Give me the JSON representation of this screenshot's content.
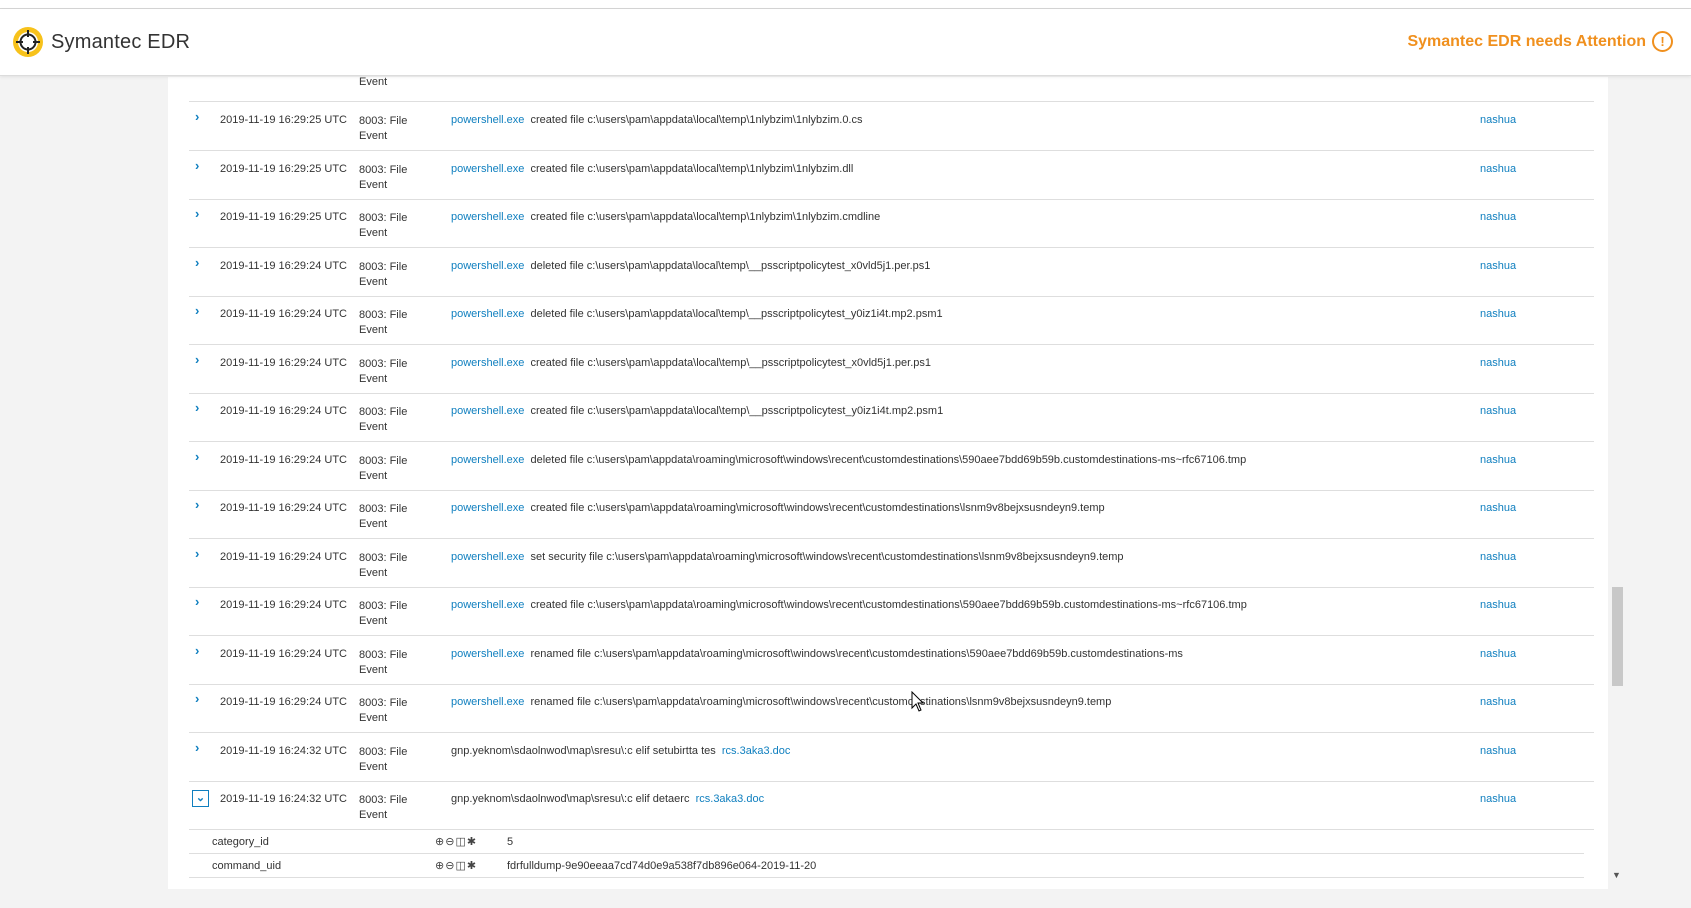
{
  "app": {
    "brand": "Symantec EDR",
    "attention": "Symantec EDR needs Attention",
    "attention_icon": "!"
  },
  "events": {
    "partial_top_type": "Event",
    "rows": [
      {
        "time": "2019-11-19 16:29:25 UTC",
        "type": "8003: File Event",
        "process": "powershell.exe",
        "action": "created file c:\\users\\pam\\appdata\\local\\temp\\1nlybzim\\1nlybzim.0.cs",
        "user": "nashua"
      },
      {
        "time": "2019-11-19 16:29:25 UTC",
        "type": "8003: File Event",
        "process": "powershell.exe",
        "action": "created file c:\\users\\pam\\appdata\\local\\temp\\1nlybzim\\1nlybzim.dll",
        "user": "nashua"
      },
      {
        "time": "2019-11-19 16:29:25 UTC",
        "type": "8003: File Event",
        "process": "powershell.exe",
        "action": "created file c:\\users\\pam\\appdata\\local\\temp\\1nlybzim\\1nlybzim.cmdline",
        "user": "nashua"
      },
      {
        "time": "2019-11-19 16:29:24 UTC",
        "type": "8003: File Event",
        "process": "powershell.exe",
        "action": "deleted file c:\\users\\pam\\appdata\\local\\temp\\__psscriptpolicytest_x0vld5j1.per.ps1",
        "user": "nashua"
      },
      {
        "time": "2019-11-19 16:29:24 UTC",
        "type": "8003: File Event",
        "process": "powershell.exe",
        "action": "deleted file c:\\users\\pam\\appdata\\local\\temp\\__psscriptpolicytest_y0iz1i4t.mp2.psm1",
        "user": "nashua"
      },
      {
        "time": "2019-11-19 16:29:24 UTC",
        "type": "8003: File Event",
        "process": "powershell.exe",
        "action": "created file c:\\users\\pam\\appdata\\local\\temp\\__psscriptpolicytest_x0vld5j1.per.ps1",
        "user": "nashua"
      },
      {
        "time": "2019-11-19 16:29:24 UTC",
        "type": "8003: File Event",
        "process": "powershell.exe",
        "action": "created file c:\\users\\pam\\appdata\\local\\temp\\__psscriptpolicytest_y0iz1i4t.mp2.psm1",
        "user": "nashua"
      },
      {
        "time": "2019-11-19 16:29:24 UTC",
        "type": "8003: File Event",
        "process": "powershell.exe",
        "action": "deleted file c:\\users\\pam\\appdata\\roaming\\microsoft\\windows\\recent\\customdestinations\\590aee7bdd69b59b.customdestinations-ms~rfc67106.tmp",
        "user": "nashua"
      },
      {
        "time": "2019-11-19 16:29:24 UTC",
        "type": "8003: File Event",
        "process": "powershell.exe",
        "action": "created file c:\\users\\pam\\appdata\\roaming\\microsoft\\windows\\recent\\customdestinations\\lsnm9v8bejxsusndeyn9.temp",
        "user": "nashua"
      },
      {
        "time": "2019-11-19 16:29:24 UTC",
        "type": "8003: File Event",
        "process": "powershell.exe",
        "action": "set security file c:\\users\\pam\\appdata\\roaming\\microsoft\\windows\\recent\\customdestinations\\lsnm9v8bejxsusndeyn9.temp",
        "user": "nashua"
      },
      {
        "time": "2019-11-19 16:29:24 UTC",
        "type": "8003: File Event",
        "process": "powershell.exe",
        "action": "created file c:\\users\\pam\\appdata\\roaming\\microsoft\\windows\\recent\\customdestinations\\590aee7bdd69b59b.customdestinations-ms~rfc67106.tmp",
        "user": "nashua"
      },
      {
        "time": "2019-11-19 16:29:24 UTC",
        "type": "8003: File Event",
        "process": "powershell.exe",
        "action": "renamed file c:\\users\\pam\\appdata\\roaming\\microsoft\\windows\\recent\\customdestinations\\590aee7bdd69b59b.customdestinations-ms",
        "user": "nashua"
      },
      {
        "time": "2019-11-19 16:29:24 UTC",
        "type": "8003: File Event",
        "process": "powershell.exe",
        "action": "renamed file c:\\users\\pam\\appdata\\roaming\\microsoft\\windows\\recent\\customdestinations\\lsnm9v8bejxsusndeyn9.temp",
        "user": "nashua"
      }
    ],
    "reversed_rows": [
      {
        "time": "2019-11-19 16:24:32 UTC",
        "type": "8003: File Event",
        "prefix": "gnp.yeknom\\sdaolnwod\\map\\sresu\\:c elif setubirtta tes",
        "link": "rcs.3aka3.doc",
        "user": "nashua"
      },
      {
        "time": "2019-11-19 16:24:32 UTC",
        "type": "8003: File Event",
        "prefix": "gnp.yeknom\\sdaolnwod\\map\\sresu\\:c elif detaerc",
        "link": "rcs.3aka3.doc",
        "user": "nashua"
      }
    ],
    "details": [
      {
        "key": "category_id",
        "value": "5"
      },
      {
        "key": "command_uid",
        "value": "fdrfulldump-9e90eeaa7cd74d0e9a538f7db896e064-2019-11-20"
      }
    ]
  },
  "colors": {
    "accent": "#0f7fbf",
    "warning": "#f0901e"
  },
  "icons": {
    "expand": "chevron-right-icon",
    "collapse": "chevron-down-icon",
    "zoom_in": "zoom-in-icon",
    "zoom_out": "zoom-out-icon",
    "columns": "columns-icon",
    "pin": "asterisk-icon"
  }
}
